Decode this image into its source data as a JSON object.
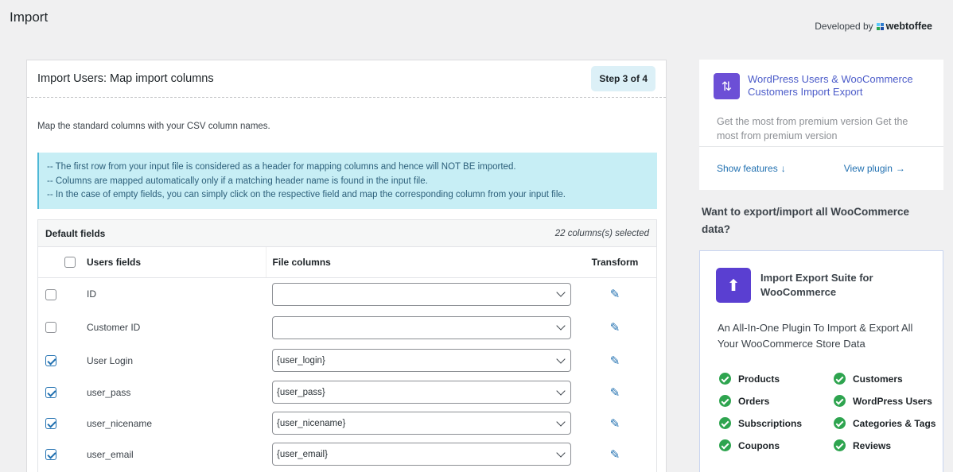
{
  "page": {
    "title": "Import"
  },
  "branding": {
    "developed_by": "Developed by",
    "logo_text": "webtoffee"
  },
  "main": {
    "title": "Import Users: Map import columns",
    "step": "Step 3 of 4",
    "intro": "Map the standard columns with your CSV column names.",
    "info_lines": [
      "-- The first row from your input file is considered as a header for mapping columns and hence will NOT BE imported.",
      "-- Columns are mapped automatically only if a matching header name is found in the input file.",
      "-- In the case of empty fields, you can simply click on the respective field and map the corresponding column from your input file."
    ],
    "fields_panel": {
      "label": "Default fields",
      "count": "22 columns(s) selected",
      "headers": {
        "users_fields": "Users fields",
        "file_columns": "File columns",
        "transform": "Transform"
      },
      "rows": [
        {
          "field": "ID",
          "value": "",
          "checked": false
        },
        {
          "field": "Customer ID",
          "value": "",
          "checked": false
        },
        {
          "field": "User Login",
          "value": "{user_login}",
          "checked": true
        },
        {
          "field": "user_pass",
          "value": "{user_pass}",
          "checked": true
        },
        {
          "field": "user_nicename",
          "value": "{user_nicename}",
          "checked": true
        },
        {
          "field": "user_email",
          "value": "{user_email}",
          "checked": true
        }
      ]
    }
  },
  "sidebar": {
    "promo1": {
      "title": "WordPress Users & WooCommerce Customers Import Export",
      "description": "Get the most from premium version Get the most from premium version",
      "show_features": "Show features",
      "view_plugin": "View plugin"
    },
    "want_text": "Want to export/import all WooCommerce data?",
    "promo2": {
      "title": "Import Export Suite for WooCommerce",
      "description": "An All-In-One Plugin To Import & Export All Your WooCommerce Store Data",
      "features": [
        "Products",
        "Customers",
        "Orders",
        "WordPress Users",
        "Subscriptions",
        "Categories & Tags",
        "Coupons",
        "Reviews"
      ]
    }
  },
  "colors": {
    "accent": "#2271b1",
    "info_bg": "#c7eef5",
    "check_green": "#2ea44f",
    "promo_purple": "#5a3fd1"
  }
}
